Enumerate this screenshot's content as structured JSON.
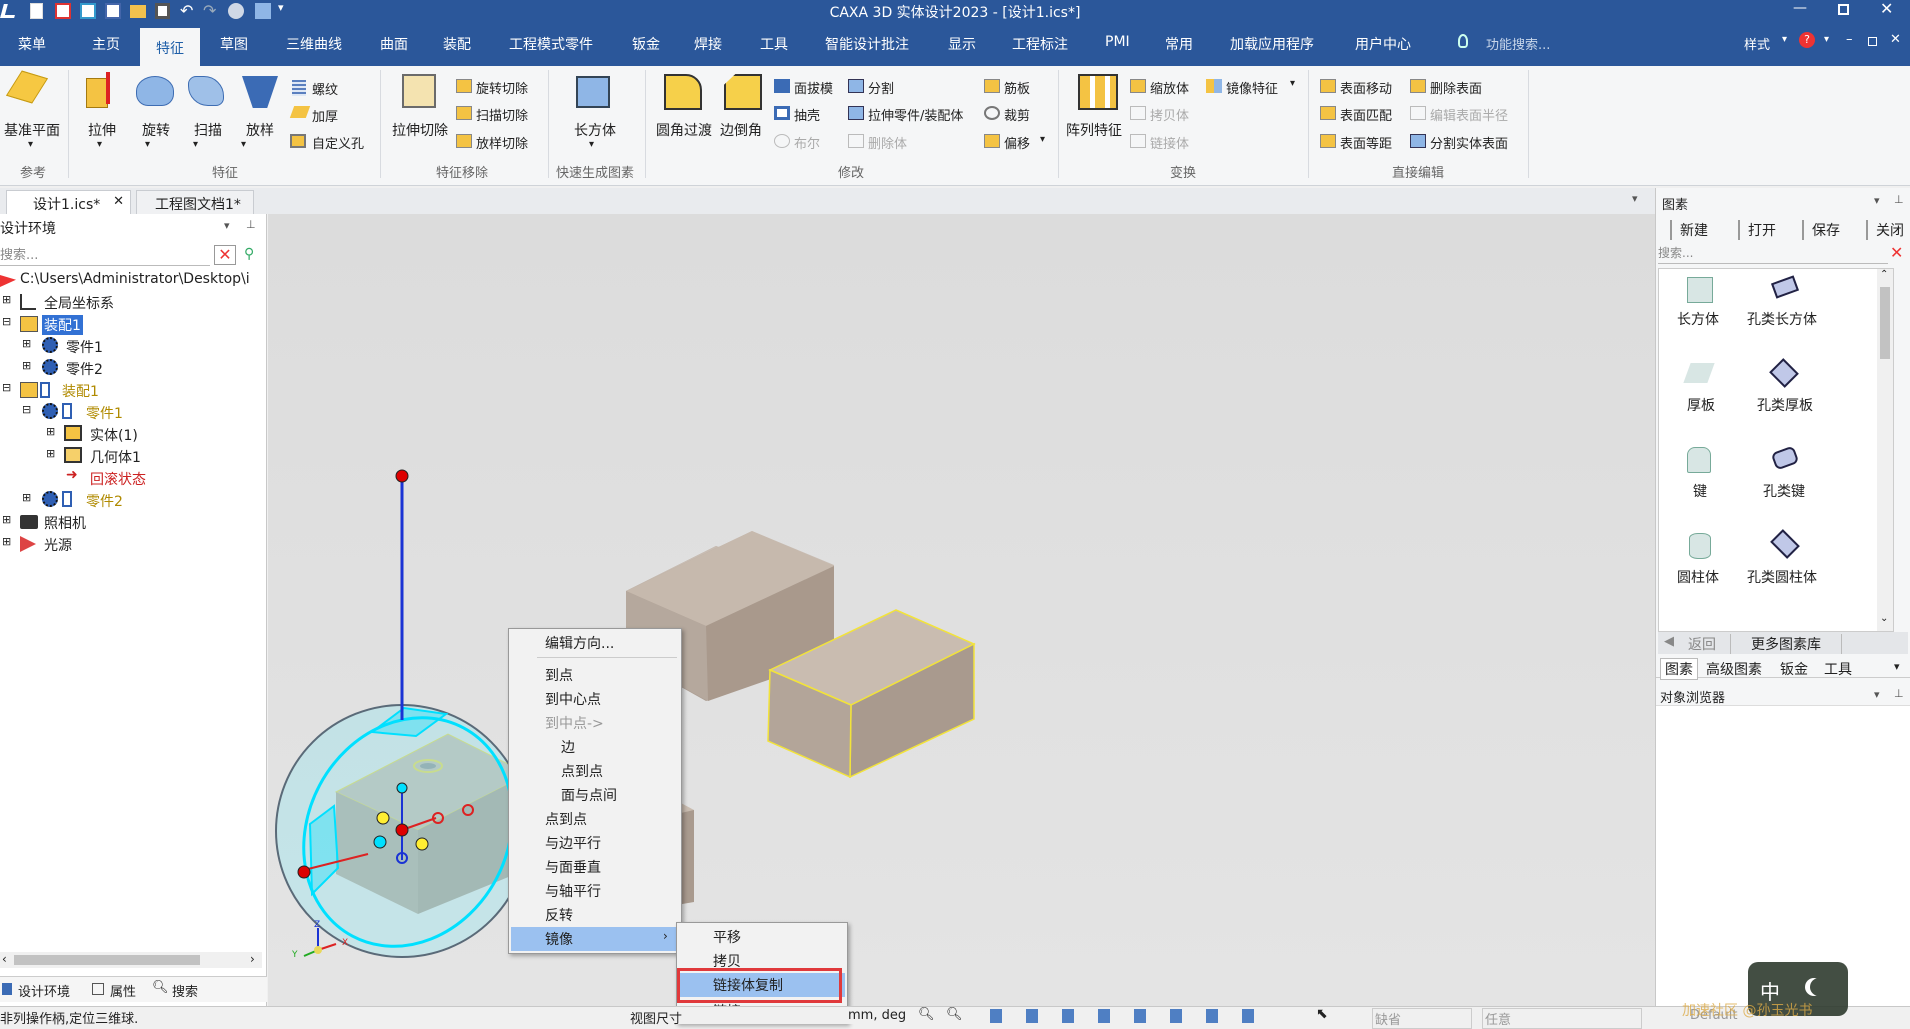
{
  "app": {
    "title": "CAXA 3D 实体设计2023 - [设计1.ics*]"
  },
  "menubar": {
    "tabs": [
      "菜单",
      "主页",
      "特征",
      "草图",
      "三维曲线",
      "曲面",
      "装配",
      "工程模式零件",
      "钣金",
      "焊接",
      "工具",
      "智能设计批注",
      "显示",
      "工程标注",
      "PMI",
      "常用",
      "加载应用程序",
      "用户中心"
    ],
    "active": "特征",
    "search_placeholder": "功能搜索...",
    "style_label": "样式"
  },
  "ribbon": {
    "groups": {
      "ref": "参考",
      "feature": "特征",
      "remove": "特征移除",
      "quick": "快速生成图素",
      "modify": "修改",
      "transform": "变换",
      "direct": "直接编辑"
    },
    "items": {
      "base_plane": "基准平面",
      "extrude": "拉伸",
      "revolve": "旋转",
      "sweep": "扫描",
      "loft": "放样",
      "thread": "螺纹",
      "thicken": "加厚",
      "custom_hole": "自定义孔",
      "extrude_cut": "拉伸切除",
      "revolve_cut": "旋转切除",
      "sweep_cut": "扫描切除",
      "loft_cut": "放样切除",
      "cuboid": "长方体",
      "fillet": "圆角过渡",
      "chamfer": "边倒角",
      "draft": "面拔模",
      "shell": "抽壳",
      "boolean": "布尔",
      "split": "分割",
      "stretch_part": "拉伸零件/装配体",
      "delete_body": "删除体",
      "rib": "筋板",
      "trim": "裁剪",
      "offset": "偏移",
      "pattern": "阵列特征",
      "scale": "缩放体",
      "mirror": "镜像特征",
      "copy_body": "拷贝体",
      "link_body": "链接体",
      "face_move": "表面移动",
      "face_match": "表面匹配",
      "face_offset": "表面等距",
      "delete_face": "删除表面",
      "edit_face_radius": "编辑表面半径",
      "split_solid_face": "分割实体表面"
    }
  },
  "doc_tabs": [
    "设计1.ics*",
    "工程图文档1*"
  ],
  "left_panel": {
    "header": "设计环境",
    "search_placeholder": "搜索...",
    "path": "C:\\Users\\Administrator\\Desktop\\i",
    "tree": [
      "全局坐标系",
      "装配1",
      "零件1",
      "零件2",
      "装配1",
      "零件1",
      "实体(1)",
      "几何体1",
      "回滚状态",
      "零件2",
      "照相机",
      "光源"
    ],
    "bottom_tabs": [
      "设计环境",
      "属性",
      "搜索"
    ]
  },
  "right_panel": {
    "header": "图素",
    "buttons": [
      "新建",
      "打开",
      "保存",
      "关闭"
    ],
    "search_placeholder": "搜索...",
    "items": [
      "长方体",
      "孔类长方体",
      "厚板",
      "孔类厚板",
      "键",
      "孔类键",
      "圆柱体",
      "孔类圆柱体"
    ],
    "back_label": "返回",
    "more_label": "更多图素库",
    "tabs": [
      "图素",
      "高级图素",
      "钣金",
      "工具"
    ],
    "object_browser": "对象浏览器"
  },
  "context_menu": {
    "items": [
      "编辑方向...",
      "到点",
      "到中心点",
      "到中点->",
      "边",
      "点到点",
      "面与点间",
      "点到点",
      "与边平行",
      "与面垂直",
      "与轴平行",
      "反转",
      "镜像"
    ],
    "submenu": [
      "平移",
      "拷贝",
      "链接体复制",
      "链接"
    ],
    "selected": "链接体复制"
  },
  "statusbar": {
    "message": "非列操作柄,定位三维球.",
    "view": "视图尺寸",
    "units": "mm, deg",
    "field1": "缺省",
    "field2": "任意",
    "field3": "Default"
  },
  "axes": {
    "z": "Z",
    "y": "Y",
    "x": "X"
  },
  "watermark": {
    "ime": "中",
    "text": "加速社区 @孙玉光书"
  },
  "colors": {
    "accent": "#2b579a",
    "selection": "#9bc1f0",
    "highlight_box": "#e0393b",
    "triball": "#00e0ff"
  }
}
